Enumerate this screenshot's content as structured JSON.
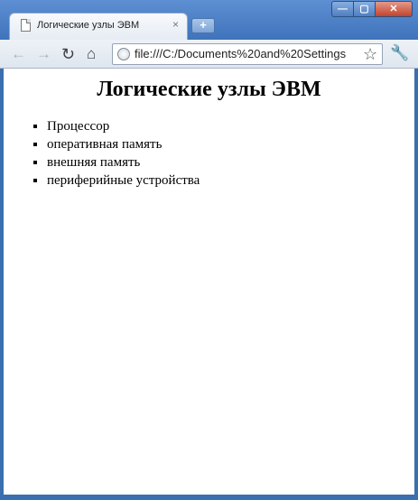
{
  "window": {
    "controls": {
      "minimize": "—",
      "maximize": "▢",
      "close": "✕"
    }
  },
  "tab": {
    "title": "Логические узлы ЭВМ",
    "close": "×",
    "new_tab": "+"
  },
  "toolbar": {
    "back_icon": "←",
    "forward_icon": "→",
    "reload_icon": "↻",
    "home_icon": "⌂",
    "url": "file:///C:/Documents%20and%20Settings",
    "star_icon": "☆",
    "wrench_icon": "🔧"
  },
  "page": {
    "heading": "Логические узлы ЭВМ",
    "items": [
      "Процессор",
      "оперативная память",
      "внешняя память",
      "периферийные устройства"
    ]
  }
}
